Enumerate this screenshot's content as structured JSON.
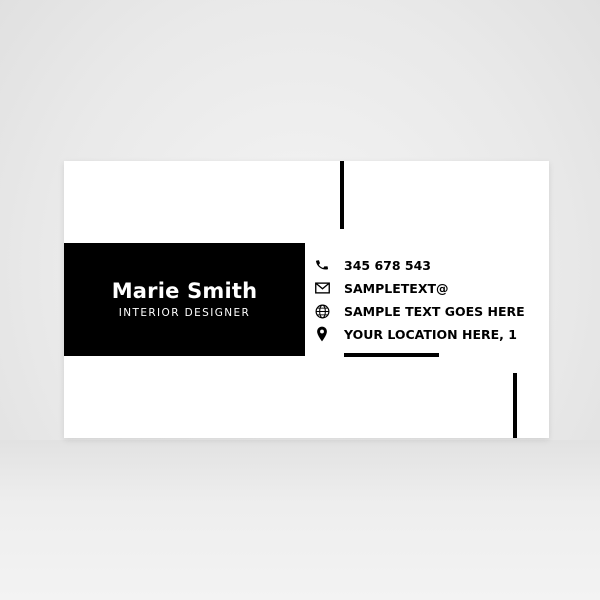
{
  "card": {
    "name": "Marie Smith",
    "role": "INTERIOR DESIGNER",
    "contacts": [
      {
        "icon": "phone-icon",
        "text": "345 678 543"
      },
      {
        "icon": "mail-icon",
        "text": "SAMPLETEXT@"
      },
      {
        "icon": "globe-icon",
        "text": "SAMPLE TEXT GOES HERE"
      },
      {
        "icon": "location-pin-icon",
        "text": "YOUR LOCATION HERE, 1"
      }
    ]
  },
  "colors": {
    "card_background": "#ffffff",
    "accent": "#000000",
    "backdrop": "#ececec"
  }
}
